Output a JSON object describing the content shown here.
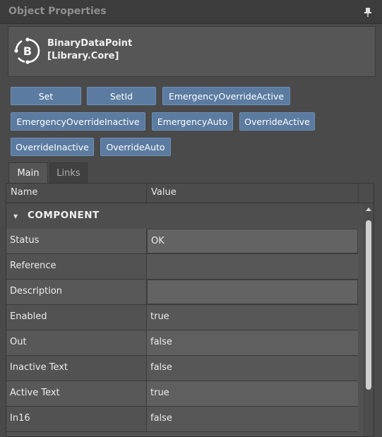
{
  "panel": {
    "title": "Object Properties",
    "pin_icon": "pin-icon"
  },
  "object": {
    "icon": "binary-datapoint-icon",
    "icon_letter": "B",
    "name_line1": "BinaryDataPoint",
    "name_line2": "[Library.Core]"
  },
  "commands": [
    "Set",
    "SetId",
    "EmergencyOverrideActive",
    "EmergencyOverrideInactive",
    "EmergencyAuto",
    "OverrideActive",
    "OverrideInactive",
    "OverrideAuto"
  ],
  "tabs": [
    {
      "label": "Main",
      "active": true
    },
    {
      "label": "Links",
      "active": false
    }
  ],
  "grid": {
    "columns": [
      "Name",
      "Value"
    ],
    "category": "COMPONENT",
    "rows": [
      {
        "name": "Status",
        "value": "OK"
      },
      {
        "name": "Reference",
        "value": ""
      },
      {
        "name": "Description",
        "value": ""
      },
      {
        "name": "Enabled",
        "value": "true"
      },
      {
        "name": "Out",
        "value": "false"
      },
      {
        "name": "Inactive Text",
        "value": "false"
      },
      {
        "name": "Active Text",
        "value": "true"
      },
      {
        "name": "In16",
        "value": "false"
      }
    ]
  },
  "colors": {
    "button_bg": "#5b7ba0",
    "panel_bg": "#4a4a4a",
    "title_text": "#8f8f8f"
  }
}
